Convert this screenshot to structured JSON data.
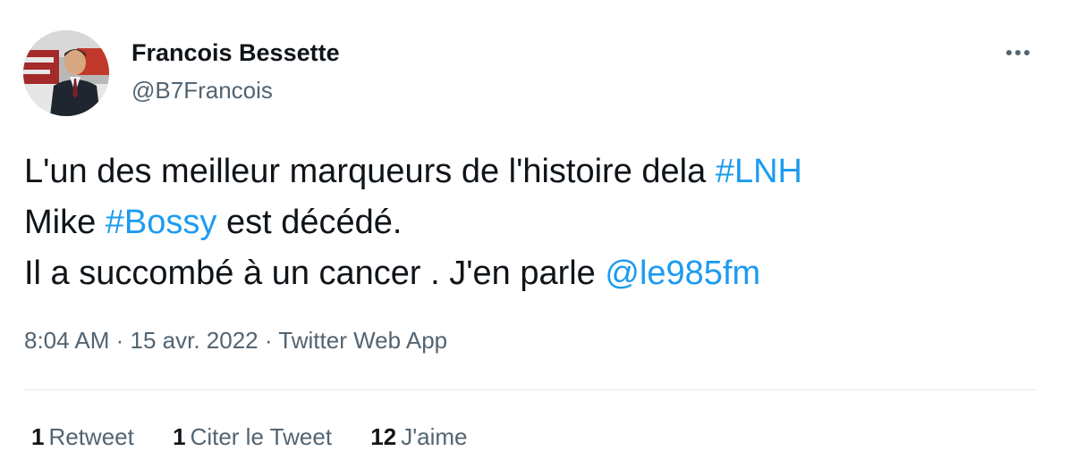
{
  "author": {
    "name": "Francois Bessette",
    "handle": "@B7Francois"
  },
  "tweet": {
    "line1": {
      "text": "L'un des meilleur marqueurs de l'histoire dela ",
      "hashtag": "#LNH"
    },
    "line2": {
      "prefix": "Mike ",
      "hashtag": "#Bossy",
      "suffix": " est décédé."
    },
    "line3": {
      "text": "Il a succombé à un cancer . J'en parle ",
      "mention": "@le985fm"
    }
  },
  "meta": {
    "time": "8:04 AM",
    "separator": " · ",
    "date": "15 avr. 2022",
    "source": "Twitter Web App"
  },
  "stats": {
    "retweets": {
      "count": "1",
      "label": "Retweet"
    },
    "quotes": {
      "count": "1",
      "label": "Citer le Tweet"
    },
    "likes": {
      "count": "12",
      "label": "J'aime"
    }
  },
  "icons": {
    "more": "more-options-icon"
  },
  "colors": {
    "link": "#1d9bf0",
    "secondary": "#536471",
    "text": "#0f1419"
  }
}
